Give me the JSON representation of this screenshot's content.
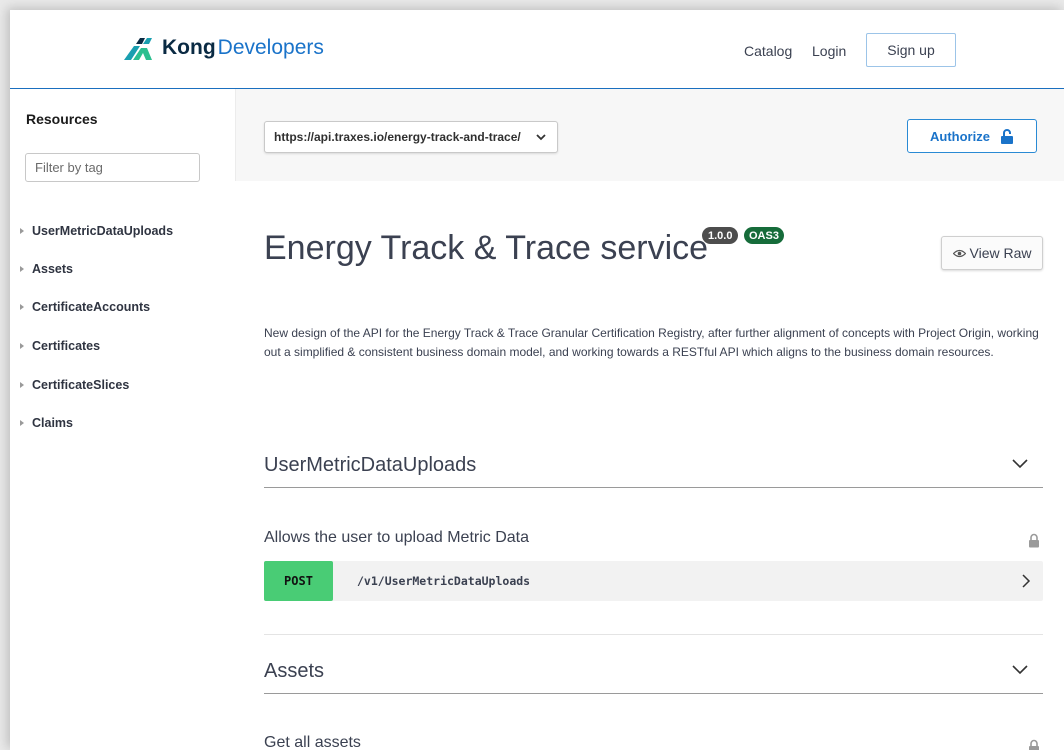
{
  "header": {
    "brand_bold": "Kong",
    "brand_light": "Developers",
    "nav": {
      "catalog": "Catalog",
      "login": "Login",
      "signup": "Sign up"
    }
  },
  "sidebar": {
    "title": "Resources",
    "filter_placeholder": "Filter by tag",
    "items": [
      {
        "label": "UserMetricDataUploads"
      },
      {
        "label": "Assets"
      },
      {
        "label": "CertificateAccounts"
      },
      {
        "label": "Certificates"
      },
      {
        "label": "CertificateSlices"
      },
      {
        "label": "Claims"
      }
    ]
  },
  "server": {
    "selected": "https://api.traxes.io/energy-track-and-trace/",
    "authorize_label": "Authorize"
  },
  "info": {
    "title": "Energy Track & Trace service",
    "version": "1.0.0",
    "spec": "OAS3",
    "view_raw": "View Raw",
    "description": "New design of the API for the Energy Track & Trace Granular Certification Registry, after further alignment of concepts with Project Origin, working out a simplified & consistent business domain model, and working towards a RESTful API which aligns to the business domain resources."
  },
  "sections": [
    {
      "name": "UserMetricDataUploads",
      "operations": [
        {
          "summary": "Allows the user to upload Metric Data",
          "method": "POST",
          "path": "/v1/UserMetricDataUploads"
        }
      ]
    },
    {
      "name": "Assets",
      "operations": [
        {
          "summary": "Get all assets"
        }
      ]
    }
  ],
  "colors": {
    "brand_dark": "#0a2a43",
    "brand_blue": "#1a73c9",
    "logo_teal": "#2bbf8f",
    "post_green": "#49cc75",
    "oas_badge": "#166c3a",
    "version_badge": "#4d4d4d"
  }
}
